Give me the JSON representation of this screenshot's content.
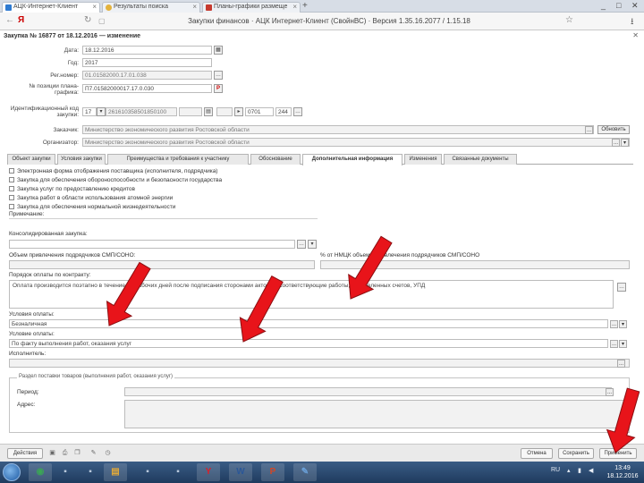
{
  "browser": {
    "tabs": [
      {
        "label": "АЦК-Интернет-Клиент",
        "active": true
      },
      {
        "label": "Результаты поиска",
        "active": false
      },
      {
        "label": "Планы-графики размеще",
        "active": false
      }
    ],
    "new_tab": "+",
    "url": "Закупки финансов · АЦК Интернет-Клиент (СвойнВС) · Версия 1.35.16.2077 / 1.15.18",
    "window_controls": [
      "_",
      "□",
      "✕"
    ]
  },
  "app": {
    "title": "Закупка № 16877 от 18.12.2016 — изменение",
    "close": "✕",
    "fields": {
      "date_label": "Дата:",
      "date_value": "18.12.2016",
      "year_label": "Год:",
      "year_value": "2017",
      "reg_label": "Рег.номер:",
      "reg_value": "01.01582000.17.01.038",
      "plan_label": "№ позиции плана-графика:",
      "plan_value": "П7.01582000017.17.0.030",
      "ikz_label": "Идентификационный код закупки:",
      "ikz_parts": [
        "17",
        "261610358501850100",
        "",
        "",
        "0701",
        "244"
      ],
      "customer_label": "Заказчик:",
      "customer_value": "Министерство экономического развития Ростовской области",
      "customer_btn": "Обновить",
      "org_label": "Организатор:",
      "org_value": "Министерство экономического развития Ростовской области"
    },
    "tabs": [
      {
        "label": "Объект закупки",
        "active": false
      },
      {
        "label": "Условия закупки",
        "active": false
      },
      {
        "label": "Преимущества и требования к участнику",
        "active": false
      },
      {
        "label": "Обоснование",
        "active": false
      },
      {
        "label": "Дополнительная информация",
        "active": true
      },
      {
        "label": "Изменения",
        "active": false
      },
      {
        "label": "Связанные документы",
        "active": false
      }
    ],
    "checkboxes": [
      "Электронная форма отображения поставщика (исполнителя, подрядчика)",
      "Закупка для обеспечения обороноспособности и безопасности государства",
      "Закупка услуг по предоставлению кредитов",
      "Закупка работ в области использования атомной энергии",
      "Закупка для обеспечения нормальной жизнедеятельности"
    ],
    "note_label": "Примечание:",
    "consolidated_label": "Консолидированная закупка:",
    "subcontract_label": "Объем привлечения подрядчиков СМП/СОНО:",
    "subcontract_pct_label": "% от НМЦК объема привлечения подрядчиков СМП/СОНО",
    "payment_label": "Порядок оплаты по контракту:",
    "payment_text": "Оплата производится поэтапно в течение 15 рабочих дней после подписания сторонами актов на соответствующие работы, выставленных счетов, УПД",
    "payment_terms_label": "Условия оплаты:",
    "payment_terms_value": "Безналичная",
    "payment_cond_label": "Условие оплаты:",
    "payment_cond_value": "По факту выполнения работ, оказания услуг",
    "executor_label": "Исполнитель:",
    "group_title": "Раздел поставки товаров (выполнения работ, оказания услуг)",
    "period_label": "Период:",
    "place_label": "Адрес:",
    "ellipsis": "...",
    "dropdown": "▾"
  },
  "bottom_toolbar": {
    "actions_label": "Действия",
    "cancel_label": "Отмена",
    "save_label": "Сохранить",
    "apply_label": "Применить"
  },
  "taskbar": {
    "apps": [
      {
        "name": "chrome",
        "glyph": "◉",
        "color": "#3aa655"
      },
      {
        "name": "explorer",
        "glyph": "▤",
        "color": "#e0a83a"
      },
      {
        "name": "yandex",
        "glyph": "Y",
        "color": "#d9202a"
      },
      {
        "name": "word",
        "glyph": "W",
        "color": "#2b5797"
      },
      {
        "name": "powerpoint",
        "glyph": "P",
        "color": "#d24726"
      },
      {
        "name": "paint",
        "glyph": "✎",
        "color": "#6aa0d8"
      }
    ],
    "lang": "RU",
    "time": "13:49",
    "date": "18.12.2016"
  },
  "colors": {
    "arrow": "#e8141a",
    "taskbar": "#2a4a73"
  }
}
